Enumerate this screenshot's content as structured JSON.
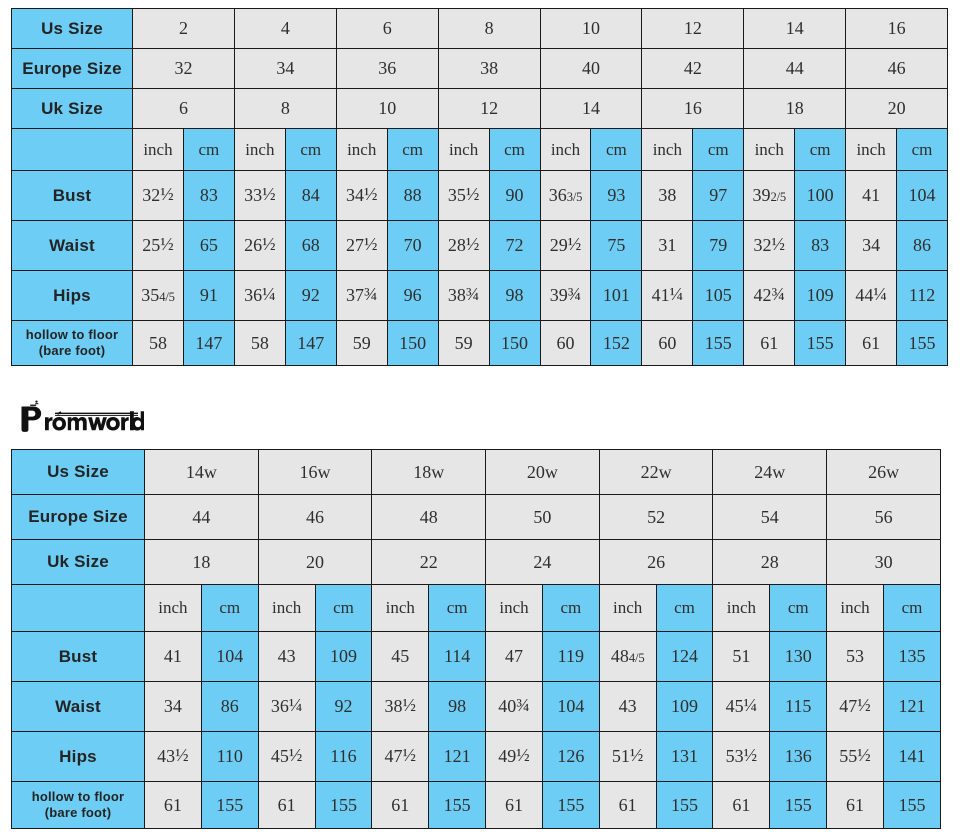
{
  "brand": {
    "name": "Promworld",
    "logo_icon": "promworld-wordmark-logo"
  },
  "tables": [
    {
      "id": "standard-size-chart",
      "row_labels": {
        "us_size": "Us Size",
        "europe_size": "Europe Size",
        "uk_size": "Uk Size",
        "unit_blank": "",
        "bust": "Bust",
        "waist": "Waist",
        "hips": "Hips",
        "hollow_to_floor_line1": "hollow to floor",
        "hollow_to_floor_line2": "(bare foot)"
      },
      "us_sizes": [
        "2",
        "4",
        "6",
        "8",
        "10",
        "12",
        "14",
        "16"
      ],
      "europe_sizes": [
        "32",
        "34",
        "36",
        "38",
        "40",
        "42",
        "44",
        "46"
      ],
      "uk_sizes": [
        "6",
        "8",
        "10",
        "12",
        "14",
        "16",
        "18",
        "20"
      ],
      "unit_inch": "inch",
      "unit_cm": "cm",
      "bust": {
        "inch": [
          "32 1/2",
          "33 1/2",
          "34 1/2",
          "35 1/2",
          "36 3/5",
          "38",
          "39 2/5",
          "41"
        ],
        "cm": [
          "83",
          "84",
          "88",
          "90",
          "93",
          "97",
          "100",
          "104"
        ]
      },
      "waist": {
        "inch": [
          "25 1/2",
          "26 1/2",
          "27 1/2",
          "28 1/2",
          "29 1/2",
          "31",
          "32 1/2",
          "34"
        ],
        "cm": [
          "65",
          "68",
          "70",
          "72",
          "75",
          "79",
          "83",
          "86"
        ]
      },
      "hips": {
        "inch": [
          "35 4/5",
          "36 1/4",
          "37 3/4",
          "38 3/4",
          "39 3/4",
          "41 1/4",
          "42 3/4",
          "44 1/4"
        ],
        "cm": [
          "91",
          "92",
          "96",
          "98",
          "101",
          "105",
          "109",
          "112"
        ]
      },
      "hollow_to_floor": {
        "inch": [
          "58",
          "58",
          "59",
          "59",
          "60",
          "60",
          "61",
          "61"
        ],
        "cm": [
          "147",
          "147",
          "150",
          "150",
          "152",
          "155",
          "155",
          "155"
        ]
      }
    },
    {
      "id": "plus-size-chart",
      "row_labels": {
        "us_size": "Us Size",
        "europe_size": "Europe Size",
        "uk_size": "Uk Size",
        "unit_blank": "",
        "bust": "Bust",
        "waist": "Waist",
        "hips": "Hips",
        "hollow_to_floor_line1": "hollow to floor",
        "hollow_to_floor_line2": "(bare foot)"
      },
      "us_sizes": [
        "14w",
        "16w",
        "18w",
        "20w",
        "22w",
        "24w",
        "26w"
      ],
      "europe_sizes": [
        "44",
        "46",
        "48",
        "50",
        "52",
        "54",
        "56"
      ],
      "uk_sizes": [
        "18",
        "20",
        "22",
        "24",
        "26",
        "28",
        "30"
      ],
      "unit_inch": "inch",
      "unit_cm": "cm",
      "bust": {
        "inch": [
          "41",
          "43",
          "45",
          "47",
          "48 4/5",
          "51",
          "53"
        ],
        "cm": [
          "104",
          "109",
          "114",
          "119",
          "124",
          "130",
          "135"
        ]
      },
      "waist": {
        "inch": [
          "34",
          "36 1/4",
          "38 1/2",
          "40 3/4",
          "43",
          "45 1/4",
          "47 1/2"
        ],
        "cm": [
          "86",
          "92",
          "98",
          "104",
          "109",
          "115",
          "121"
        ]
      },
      "hips": {
        "inch": [
          "43 1/2",
          "45 1/2",
          "47 1/2",
          "49 1/2",
          "51 1/2",
          "53 1/2",
          "55 1/2"
        ],
        "cm": [
          "110",
          "116",
          "121",
          "126",
          "131",
          "136",
          "141"
        ]
      },
      "hollow_to_floor": {
        "inch": [
          "61",
          "61",
          "61",
          "61",
          "61",
          "61",
          "61"
        ],
        "cm": [
          "155",
          "155",
          "155",
          "155",
          "155",
          "155",
          "155"
        ]
      }
    }
  ],
  "colors": {
    "accent_blue": "#6ecdf5",
    "cell_gray": "#e6e6e6",
    "border": "#1a1a1a",
    "text": "#2f2f2f"
  }
}
